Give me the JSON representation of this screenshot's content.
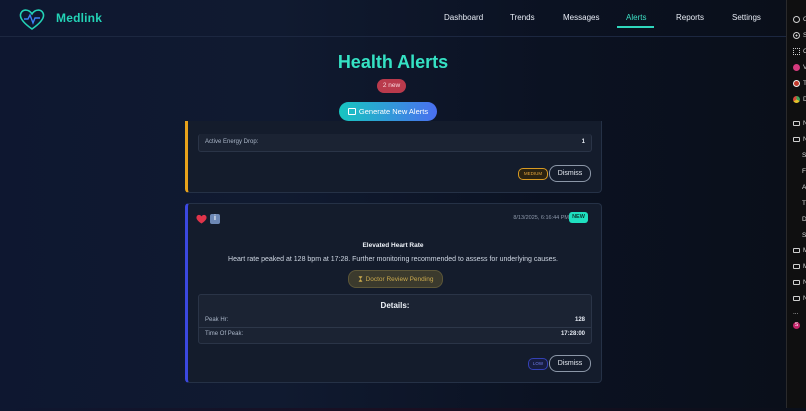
{
  "app": {
    "name": "Medlink"
  },
  "nav": {
    "links": [
      "Dashboard",
      "Trends",
      "Messages",
      "Alerts",
      "Reports",
      "Settings"
    ],
    "active": "Alerts"
  },
  "page": {
    "title": "Health Alerts",
    "new_count_label": "2 new",
    "generate_button": "Generate New Alerts"
  },
  "alerts": [
    {
      "metrics": [
        {
          "key": "Active Energy Drop:",
          "value": "1"
        }
      ],
      "severity": "MEDIUM",
      "dismiss": "Dismiss",
      "accent_color": "#e8a21b"
    },
    {
      "timestamp": "8/13/2025, 6:16:44 PM",
      "new_label": "NEW",
      "title": "Elevated Heart Rate",
      "description": "Heart rate peaked at 128 bpm at 17:28. Further monitoring recommended to assess for underlying causes.",
      "review_status": "Doctor Review Pending",
      "details_title": "Details:",
      "metrics": [
        {
          "key": "Peak Hr:",
          "value": "128"
        },
        {
          "key": "Time Of Peak:",
          "value": "17:28:00"
        }
      ],
      "severity": "LOW",
      "dismiss": "Dismiss",
      "accent_color": "#3b48e0"
    }
  ],
  "side_panel": {
    "items": [
      "C",
      "S",
      "C",
      "V",
      "T",
      "D",
      "N",
      "N",
      "S",
      "F",
      "A",
      "T",
      "D",
      "S",
      "M",
      "M",
      "N",
      "N",
      "...",
      "S"
    ]
  },
  "colors": {
    "brand": "#23d3b6",
    "new_badge": "#b93a4c",
    "new_pill": "#1fe0c0"
  }
}
